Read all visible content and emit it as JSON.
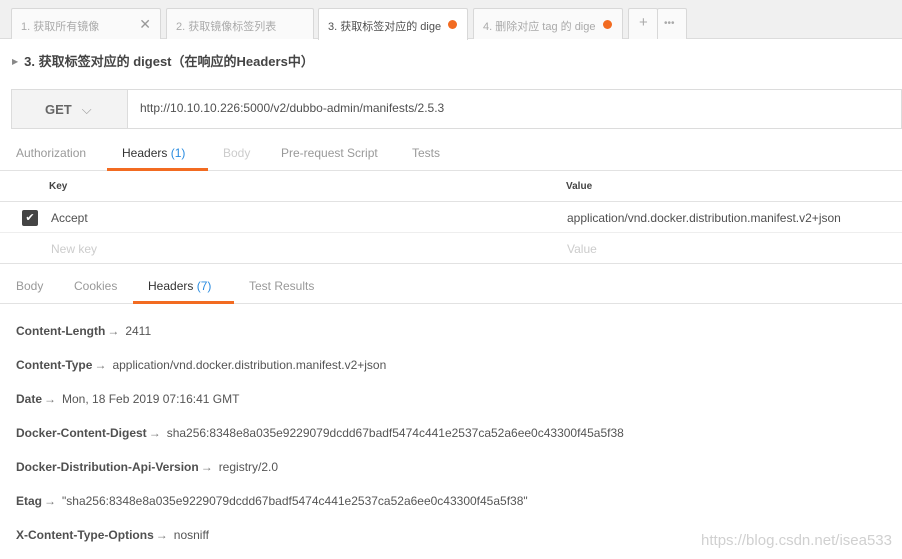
{
  "tabs": [
    {
      "label": "1. 获取所有镜像",
      "icon": "close-icon",
      "glyph": "✕"
    },
    {
      "label": "2. 获取镜像标签列表"
    },
    {
      "label": "3. 获取标签对应的 dige",
      "unsaved": true
    },
    {
      "label": "4. 删除对应 tag 的 dige",
      "unsaved": true
    }
  ],
  "tab_actions": {
    "add": "+",
    "more": "•••"
  },
  "request_title": "3. 获取标签对应的 digest（在响应的Headers中）",
  "method": "GET",
  "url": "http://10.10.10.226:5000/v2/dubbo-admin/manifests/2.5.3",
  "request_tabs": [
    {
      "label": "Authorization"
    },
    {
      "label": "Headers",
      "count": "(1)"
    },
    {
      "label": "Body"
    },
    {
      "label": "Pre-request Script"
    },
    {
      "label": "Tests"
    }
  ],
  "headers_table": {
    "key_col": "Key",
    "value_col": "Value",
    "rows": [
      {
        "checked": true,
        "key": "Accept",
        "value": "application/vnd.docker.distribution.manifest.v2+json"
      }
    ],
    "new_key_placeholder": "New key",
    "new_value_placeholder": "Value"
  },
  "response_tabs": [
    {
      "label": "Body"
    },
    {
      "label": "Cookies"
    },
    {
      "label": "Headers",
      "count": "(7)"
    },
    {
      "label": "Test Results"
    }
  ],
  "response_headers": [
    {
      "name": "Content-Length",
      "value": "2411"
    },
    {
      "name": "Content-Type",
      "value": "application/vnd.docker.distribution.manifest.v2+json"
    },
    {
      "name": "Date",
      "value": "Mon, 18 Feb 2019 07:16:41 GMT"
    },
    {
      "name": "Docker-Content-Digest",
      "value": "sha256:8348e8a035e9229079dcdd67badf5474c441e2537ca52a6ee0c43300f45a5f38"
    },
    {
      "name": "Docker-Distribution-Api-Version",
      "value": "registry/2.0"
    },
    {
      "name": "Etag",
      "value": "\"sha256:8348e8a035e9229079dcdd67badf5474c441e2537ca52a6ee0c43300f45a5f38\""
    },
    {
      "name": "X-Content-Type-Options",
      "value": "nosniff"
    }
  ],
  "arrow": "→",
  "watermark": "https://blog.csdn.net/isea533",
  "colors": {
    "accent": "#f26b21",
    "count": "#2a8ce0"
  }
}
